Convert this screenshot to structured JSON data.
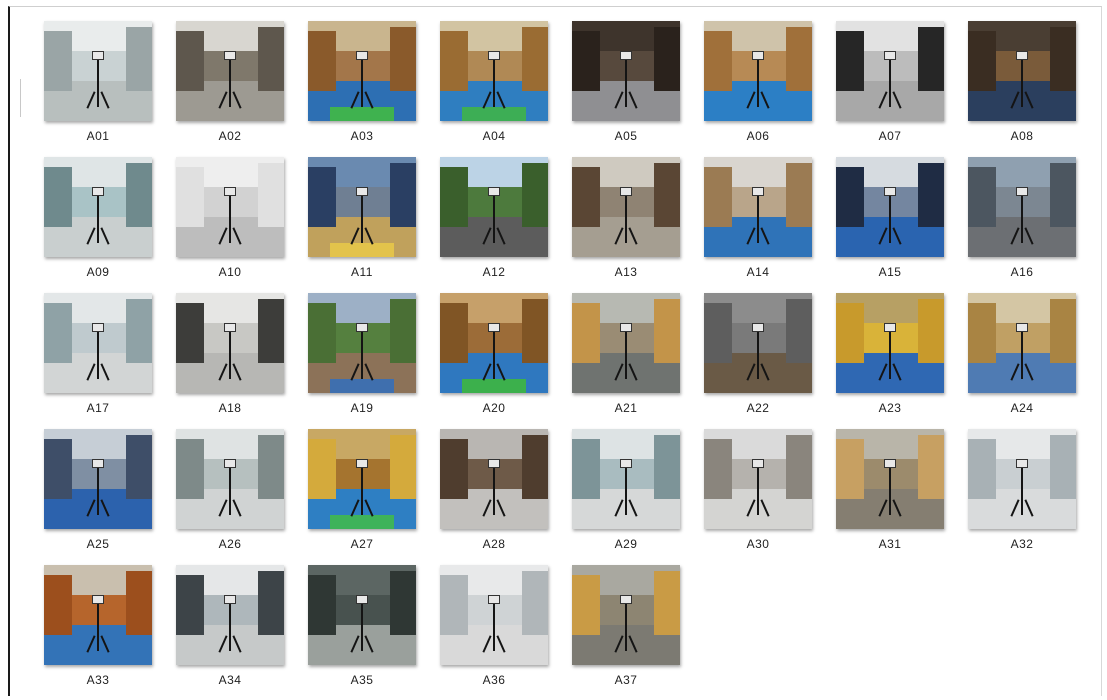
{
  "images": [
    {
      "label": "A01",
      "palette": {
        "ceiling": "#e9ecec",
        "wall": "#c9d2d3",
        "floor": "#b8bfbe",
        "side": "#9aa5a6",
        "stripe": "#b8bfbe"
      }
    },
    {
      "label": "A02",
      "palette": {
        "ceiling": "#d8d6d0",
        "wall": "#7f786b",
        "floor": "#9d9a92",
        "side": "#5e574d",
        "stripe": "#9d9a92"
      }
    },
    {
      "label": "A03",
      "palette": {
        "ceiling": "#c9b58e",
        "wall": "#a3764a",
        "floor": "#2d6fb3",
        "side": "#8a5a2b",
        "stripe": "#3fb24f"
      }
    },
    {
      "label": "A04",
      "palette": {
        "ceiling": "#d2c4a2",
        "wall": "#b08955",
        "floor": "#2f7ec0",
        "side": "#9a6c33",
        "stripe": "#3dae55"
      }
    },
    {
      "label": "A05",
      "palette": {
        "ceiling": "#3e342c",
        "wall": "#57493d",
        "floor": "#8f8f92",
        "side": "#2a221c",
        "stripe": "#8f8f92"
      }
    },
    {
      "label": "A06",
      "palette": {
        "ceiling": "#cfc3aa",
        "wall": "#b78a55",
        "floor": "#2c7fc5",
        "side": "#a0703a",
        "stripe": "#2c7fc5"
      }
    },
    {
      "label": "A07",
      "palette": {
        "ceiling": "#e2e2e2",
        "wall": "#bcbcbc",
        "floor": "#a8a8a8",
        "side": "#262626",
        "stripe": "#a8a8a8"
      }
    },
    {
      "label": "A08",
      "palette": {
        "ceiling": "#4a3e33",
        "wall": "#7a5b3a",
        "floor": "#2b3f5e",
        "side": "#3a2d22",
        "stripe": "#2b3f5e"
      }
    },
    {
      "label": "A09",
      "palette": {
        "ceiling": "#dfe5e6",
        "wall": "#a9c3c6",
        "floor": "#c9cfcf",
        "side": "#6f8a8d",
        "stripe": "#c9cfcf"
      }
    },
    {
      "label": "A10",
      "palette": {
        "ceiling": "#eeeeee",
        "wall": "#d2d2d2",
        "floor": "#bdbdbd",
        "side": "#e0e0e0",
        "stripe": "#bdbdbd"
      }
    },
    {
      "label": "A11",
      "palette": {
        "ceiling": "#6a8ab0",
        "wall": "#6f7f93",
        "floor": "#c0a15c",
        "side": "#2a3f63",
        "stripe": "#e3c34b"
      }
    },
    {
      "label": "A12",
      "palette": {
        "ceiling": "#bcd3e6",
        "wall": "#4d7a3d",
        "floor": "#5c5c5c",
        "side": "#3a5f2c",
        "stripe": "#5c5c5c"
      }
    },
    {
      "label": "A13",
      "palette": {
        "ceiling": "#cfcac0",
        "wall": "#8f8373",
        "floor": "#a59e91",
        "side": "#5a4634",
        "stripe": "#a59e91"
      }
    },
    {
      "label": "A14",
      "palette": {
        "ceiling": "#d9d5cf",
        "wall": "#b9a58a",
        "floor": "#2f73b8",
        "side": "#9b7b53",
        "stripe": "#2f73b8"
      }
    },
    {
      "label": "A15",
      "palette": {
        "ceiling": "#d6dbe0",
        "wall": "#7486a0",
        "floor": "#2a64b0",
        "side": "#1f2c44",
        "stripe": "#2a64b0"
      }
    },
    {
      "label": "A16",
      "palette": {
        "ceiling": "#8fa0b0",
        "wall": "#7c8792",
        "floor": "#6c6f73",
        "side": "#4c5660",
        "stripe": "#6c6f73"
      }
    },
    {
      "label": "A17",
      "palette": {
        "ceiling": "#e3e7e8",
        "wall": "#bfcace",
        "floor": "#d2d5d5",
        "side": "#8fa2a6",
        "stripe": "#d2d5d5"
      }
    },
    {
      "label": "A18",
      "palette": {
        "ceiling": "#e6e6e4",
        "wall": "#c8c8c4",
        "floor": "#b7b7b4",
        "side": "#3d3d3a",
        "stripe": "#b7b7b4"
      }
    },
    {
      "label": "A19",
      "palette": {
        "ceiling": "#9db0c6",
        "wall": "#55803f",
        "floor": "#8c7258",
        "side": "#4a6f35",
        "stripe": "#3f6fae"
      }
    },
    {
      "label": "A20",
      "palette": {
        "ceiling": "#c6a06a",
        "wall": "#9c6c38",
        "floor": "#2f78bf",
        "side": "#805525",
        "stripe": "#3cb04c"
      }
    },
    {
      "label": "A21",
      "palette": {
        "ceiling": "#b7b9b2",
        "wall": "#9a8c74",
        "floor": "#6f7370",
        "side": "#c39449",
        "stripe": "#6f7370"
      }
    },
    {
      "label": "A22",
      "palette": {
        "ceiling": "#8c8c8c",
        "wall": "#7a7a7a",
        "floor": "#6a5a46",
        "side": "#5e5e5e",
        "stripe": "#6a5a46"
      }
    },
    {
      "label": "A23",
      "palette": {
        "ceiling": "#b7a064",
        "wall": "#d9b339",
        "floor": "#2f68b3",
        "side": "#c89a2c",
        "stripe": "#2f68b3"
      }
    },
    {
      "label": "A24",
      "palette": {
        "ceiling": "#d4c6a4",
        "wall": "#c0a064",
        "floor": "#4f7bb3",
        "side": "#a98443",
        "stripe": "#4f7bb3"
      }
    },
    {
      "label": "A25",
      "palette": {
        "ceiling": "#c6ced6",
        "wall": "#7f8fa3",
        "floor": "#2c62ad",
        "side": "#3e4e68",
        "stripe": "#2c62ad"
      }
    },
    {
      "label": "A26",
      "palette": {
        "ceiling": "#dfe3e3",
        "wall": "#b6c0bf",
        "floor": "#d0d3d3",
        "side": "#7e8a89",
        "stripe": "#d0d3d3"
      }
    },
    {
      "label": "A27",
      "palette": {
        "ceiling": "#c8a864",
        "wall": "#a5742f",
        "floor": "#2e7fc3",
        "side": "#d4aa3c",
        "stripe": "#3eb35a"
      }
    },
    {
      "label": "A28",
      "palette": {
        "ceiling": "#b9b6b2",
        "wall": "#6e5a48",
        "floor": "#c2c0bd",
        "side": "#4f3d2e",
        "stripe": "#c2c0bd"
      }
    },
    {
      "label": "A29",
      "palette": {
        "ceiling": "#dde3e4",
        "wall": "#a9bcc0",
        "floor": "#d6d8d8",
        "side": "#7d9498",
        "stripe": "#d6d8d8"
      }
    },
    {
      "label": "A30",
      "palette": {
        "ceiling": "#dadada",
        "wall": "#b5b2ad",
        "floor": "#d4d4d2",
        "side": "#8a857d",
        "stripe": "#d4d4d2"
      }
    },
    {
      "label": "A31",
      "palette": {
        "ceiling": "#b9b5a9",
        "wall": "#9c8b6c",
        "floor": "#857e71",
        "side": "#c7a062",
        "stripe": "#857e71"
      }
    },
    {
      "label": "A32",
      "palette": {
        "ceiling": "#e6e8e9",
        "wall": "#c9cfd2",
        "floor": "#d9dbdc",
        "side": "#a8b1b5",
        "stripe": "#d9dbdc"
      }
    },
    {
      "label": "A33",
      "palette": {
        "ceiling": "#c9bfae",
        "wall": "#b6652c",
        "floor": "#3373b7",
        "side": "#9c4f1d",
        "stripe": "#3373b7"
      }
    },
    {
      "label": "A34",
      "palette": {
        "ceiling": "#e5e7e8",
        "wall": "#aeb7bb",
        "floor": "#c6c9c9",
        "side": "#3d4448",
        "stripe": "#c6c9c9"
      }
    },
    {
      "label": "A35",
      "palette": {
        "ceiling": "#5c6663",
        "wall": "#48524f",
        "floor": "#9aa09c",
        "side": "#2f3734",
        "stripe": "#9aa09c"
      }
    },
    {
      "label": "A36",
      "palette": {
        "ceiling": "#e8e9ea",
        "wall": "#cfd3d5",
        "floor": "#d9d9d9",
        "side": "#b0b6b9",
        "stripe": "#d9d9d9"
      }
    },
    {
      "label": "A37",
      "palette": {
        "ceiling": "#a9a8a0",
        "wall": "#8d8572",
        "floor": "#7c7a72",
        "side": "#c99b45",
        "stripe": "#7c7a72"
      }
    }
  ]
}
